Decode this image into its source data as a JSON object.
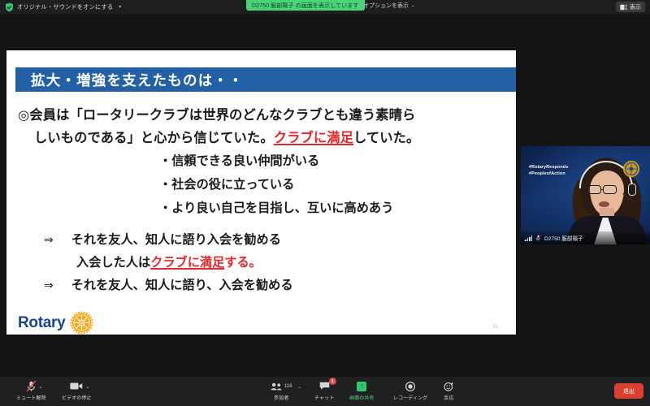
{
  "topbar": {
    "original_sound_label": "オリジナル・サウンドをオンにする",
    "shield_icon": "shield-check-icon",
    "caret_icon": "chevron-down-icon",
    "share_banner_text": "D2750 服部陽子 の画面を表示しています",
    "banner_options_label": "オプションを表示",
    "banner_options_caret": "∨",
    "view_button_label": "表示",
    "view_button_icon": "layout-view-icon",
    "banner_color": "#4bd37b"
  },
  "slide": {
    "title": "拡大・増強を支えたものは・・",
    "title_bar_color": "#2360a5",
    "paragraph": {
      "line1_a": "◎会員は「ロータリークラブは世界のどんなクラブとも違う素晴ら",
      "line2_a": "しいものである」と心から信じていた。",
      "line2_hl": "クラブに満足",
      "line2_b": "していた。"
    },
    "bullets": [
      "・信頼できる良い仲間がいる",
      "・社会の役に立っている",
      "・より良い自己を目指し、互いに高めあう"
    ],
    "conclusions": [
      {
        "arrow": "⇒",
        "text": "それを友人、知人に語り入会を勧める"
      },
      {
        "arrow": "⇒",
        "text": "それを友人、知人に語り、入会を勧める"
      }
    ],
    "sub_line": {
      "prefix": "入会した人は",
      "highlight": "クラブに満足",
      "suffix": "する。"
    },
    "logo_word": "Rotary",
    "logo_wheel_icon": "rotary-wheel-icon",
    "page_number": "31",
    "accent_red": "#e0282e",
    "logo_blue": "#17458f",
    "logo_gold": "#f7a81b"
  },
  "video": {
    "hashtags": "#RotaryResponds\n#PeopleofAction",
    "participant_name": "D2750 服部陽子",
    "signal_icon": "signal-bars-icon",
    "mute_icon": "mic-muted-icon",
    "emblem_icon": "rotary-emblem-icon"
  },
  "toolbar": {
    "items": [
      {
        "label": "ミュート解除",
        "icon": "mic-muted-icon",
        "has_caret": true
      },
      {
        "label": "ビデオの停止",
        "icon": "video-camera-icon",
        "has_caret": true
      },
      {
        "label": "参加者",
        "icon": "participants-icon",
        "count": "116",
        "has_caret": true
      },
      {
        "label": "チャット",
        "icon": "chat-bubble-icon",
        "badge": "1"
      },
      {
        "label": "画面の共有",
        "icon": "share-screen-icon",
        "highlight": true
      },
      {
        "label": "レコーディング",
        "icon": "record-circle-icon"
      },
      {
        "label": "反応",
        "icon": "reactions-smiley-icon"
      }
    ],
    "leave_label": "退出",
    "leave_color": "#d9402f"
  }
}
